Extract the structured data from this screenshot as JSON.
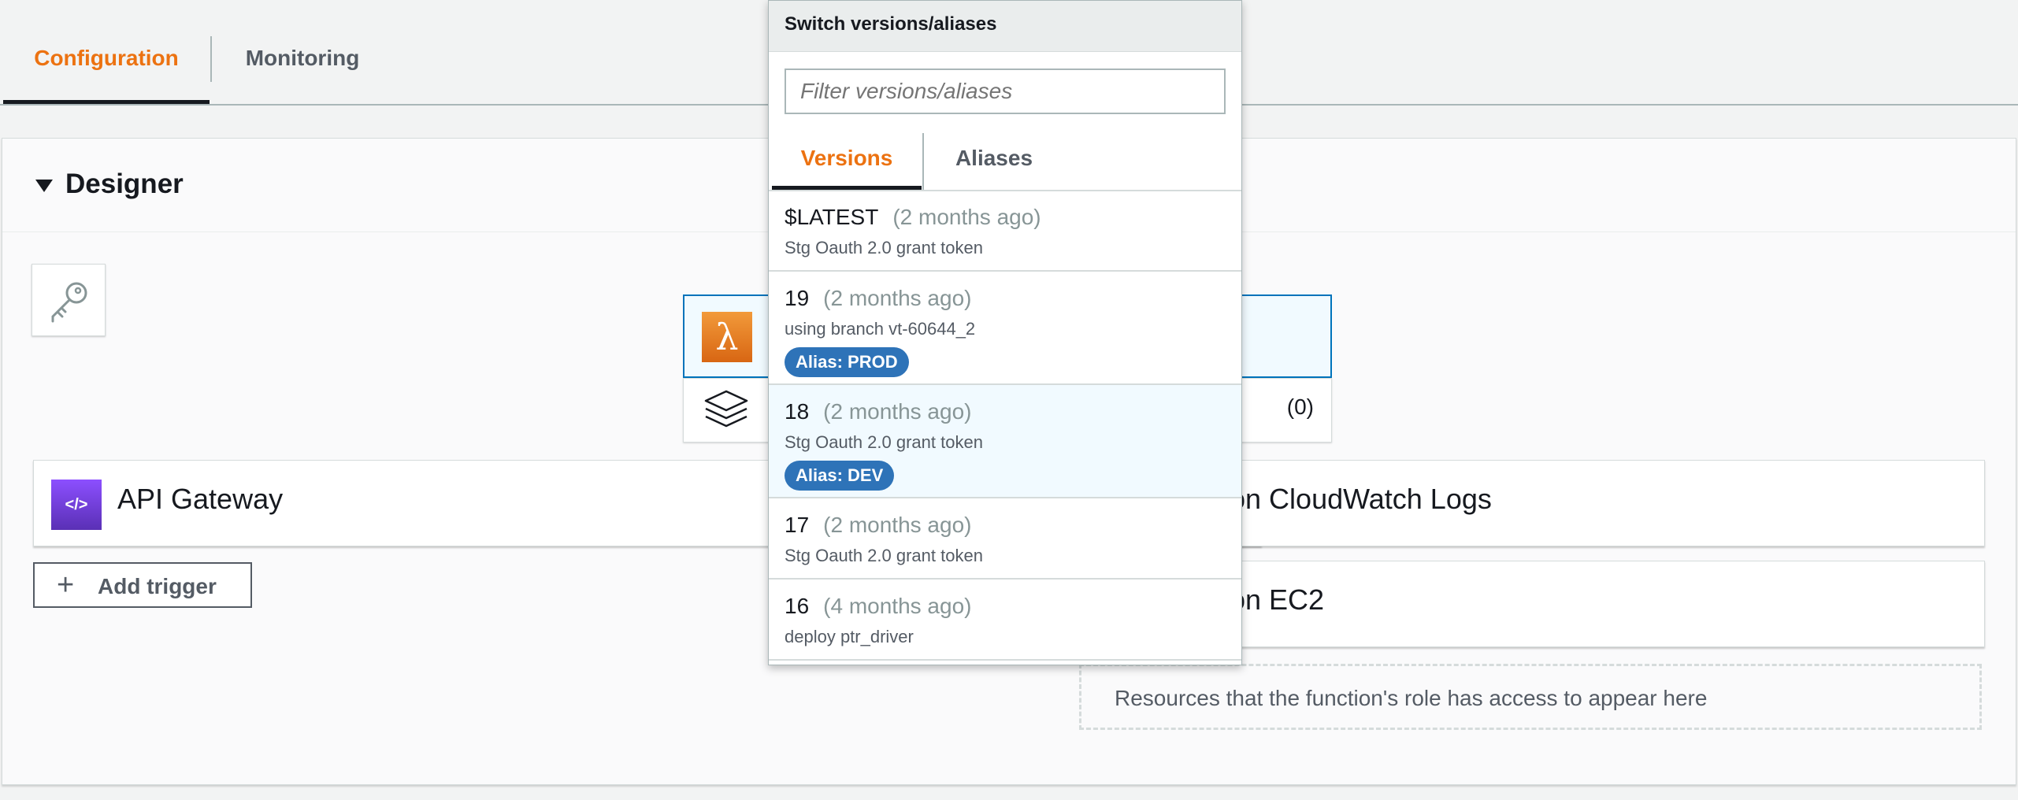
{
  "tabs": {
    "configuration": "Configuration",
    "monitoring": "Monitoring"
  },
  "designer": {
    "title": "Designer",
    "layers_count": "(0)",
    "triggers": [
      {
        "label": "API Gateway"
      }
    ],
    "add_trigger_label": "Add trigger",
    "destinations": [
      {
        "label": "on CloudWatch Logs"
      },
      {
        "label": "on EC2"
      }
    ],
    "resources_hint": "Resources that the function's role has access to appear here"
  },
  "dropdown": {
    "title": "Switch versions/aliases",
    "filter_placeholder": "Filter versions/aliases",
    "tabs": {
      "versions": "Versions",
      "aliases": "Aliases"
    },
    "versions": [
      {
        "number": "$LATEST",
        "age": "(2 months ago)",
        "description": "Stg Oauth 2.0 grant token",
        "alias": ""
      },
      {
        "number": "19",
        "age": "(2 months ago)",
        "description": "using branch vt-60644_2",
        "alias": "Alias: PROD"
      },
      {
        "number": "18",
        "age": "(2 months ago)",
        "description": "Stg Oauth 2.0 grant token",
        "alias": "Alias: DEV"
      },
      {
        "number": "17",
        "age": "(2 months ago)",
        "description": "Stg Oauth 2.0 grant token",
        "alias": ""
      },
      {
        "number": "16",
        "age": "(4 months ago)",
        "description": "deploy ptr_driver",
        "alias": ""
      }
    ]
  }
}
